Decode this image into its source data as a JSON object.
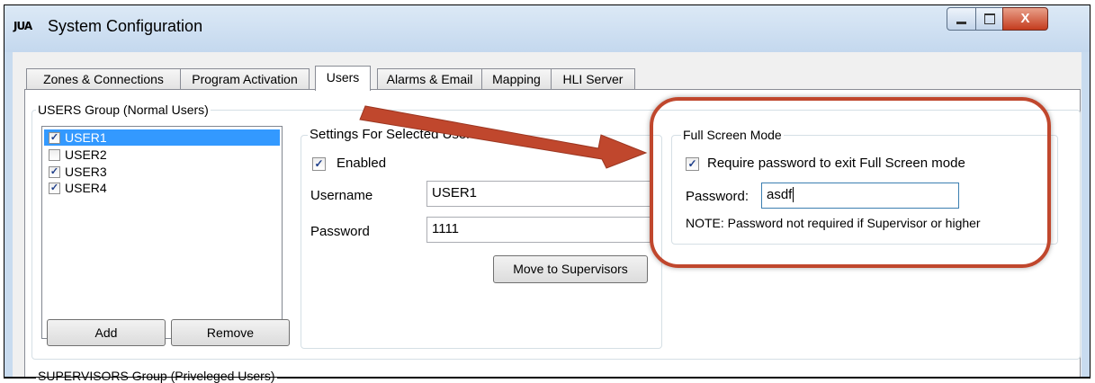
{
  "window": {
    "app_icon_text": "JUA",
    "title": "System Configuration",
    "close_glyph": "X",
    "colors": {
      "titlebar": "#c4d8ee",
      "close_button": "#c43c1e",
      "selection": "#3399ff",
      "highlight": "#c0472d"
    }
  },
  "tabs": [
    {
      "label": "Zones & Connections"
    },
    {
      "label": "Program Activation"
    },
    {
      "label": "Users",
      "active": true
    },
    {
      "label": "Alarms & Email"
    },
    {
      "label": "Mapping"
    },
    {
      "label": "HLI Server"
    }
  ],
  "users_group": {
    "label": "USERS Group (Normal Users)",
    "users": [
      {
        "name": "USER1",
        "checked": true,
        "selected": true
      },
      {
        "name": "USER2",
        "checked": false
      },
      {
        "name": "USER3",
        "checked": true
      },
      {
        "name": "USER4",
        "checked": true
      }
    ],
    "add_label": "Add",
    "remove_label": "Remove"
  },
  "settings": {
    "label": "Settings For Selected User",
    "enabled_label": "Enabled",
    "username_label": "Username",
    "username_value": "USER1",
    "password_label": "Password",
    "password_value": "1111",
    "move_button": "Move to Supervisors"
  },
  "fullscreen": {
    "label": "Full Screen Mode",
    "require_label": "Require password to exit Full Screen mode",
    "password_label": "Password:",
    "password_value": "asdf",
    "note": "NOTE: Password not required if Supervisor or higher"
  },
  "supervisors_group": {
    "label": "SUPERVISORS Group (Priveleged Users)"
  }
}
